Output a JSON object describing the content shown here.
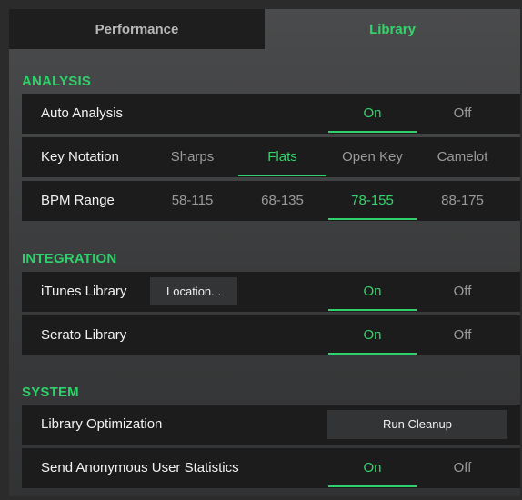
{
  "tabs": {
    "performance": "Performance",
    "library": "Library"
  },
  "sections": {
    "analysis": "ANALYSIS",
    "integration": "INTEGRATION",
    "system": "SYSTEM"
  },
  "auto_analysis": {
    "label": "Auto Analysis",
    "on": "On",
    "off": "Off",
    "selected": "On"
  },
  "key_notation": {
    "label": "Key Notation",
    "options": [
      "Sharps",
      "Flats",
      "Open Key",
      "Camelot"
    ],
    "selected": "Flats"
  },
  "bpm_range": {
    "label": "BPM Range",
    "options": [
      "58-115",
      "68-135",
      "78-155",
      "88-175"
    ],
    "selected": "78-155"
  },
  "itunes_library": {
    "label": "iTunes Library",
    "button": "Location...",
    "on": "On",
    "off": "Off",
    "selected": "On"
  },
  "serato_library": {
    "label": "Serato Library",
    "on": "On",
    "off": "Off",
    "selected": "On"
  },
  "library_optimization": {
    "label": "Library Optimization",
    "button": "Run Cleanup"
  },
  "anonymous_stats": {
    "label": "Send Anonymous User Statistics",
    "on": "On",
    "off": "Off",
    "selected": "On"
  },
  "colors": {
    "accent": "#2fd16a",
    "row_bg": "#1c1c1c",
    "tab_inactive_bg": "#1e1e1e"
  }
}
